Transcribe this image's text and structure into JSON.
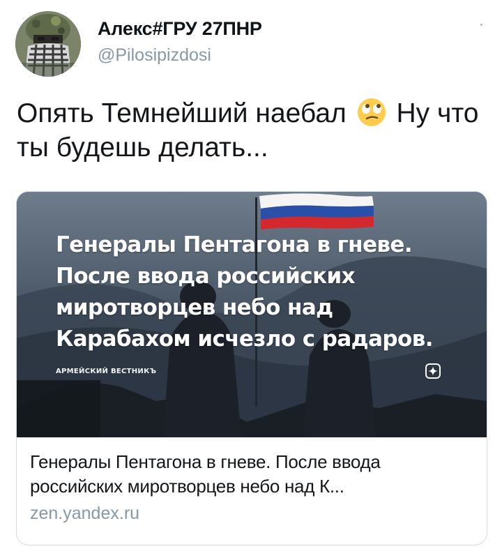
{
  "tweet": {
    "author": {
      "display_name": "Алекс#ГРУ 27ПНР",
      "handle": "@Pilosipizdosi",
      "avatar": "avatar-soldier-image"
    },
    "text_before_emoji": "Опять Темнейший наебал",
    "emoji": "face-with-rolling-eyes-emoji",
    "text_after_emoji": "Ну что ты будешь делать...",
    "icons": {
      "more": "more-options-icon"
    }
  },
  "card": {
    "image": {
      "headline_lines": [
        "Генералы Пентагона в гневе.",
        "После ввода российских",
        "миротворцев небо над",
        "Карабахом исчезло с радаров."
      ],
      "source_label": "АРМЕЙСКИЙ ВЕСТНИКЪ",
      "source_icon": "zen-logo-icon"
    },
    "title": "Генералы Пентагона в гневе. После ввода российских миротворцев небо над К...",
    "domain": "zen.yandex.ru"
  },
  "colors": {
    "text_primary": "#14171a",
    "text_secondary": "#8899a6",
    "card_border": "#d3dce3",
    "flag_white": "#f4f4f4",
    "flag_blue": "#2a4fa8",
    "flag_red": "#d2282e"
  }
}
